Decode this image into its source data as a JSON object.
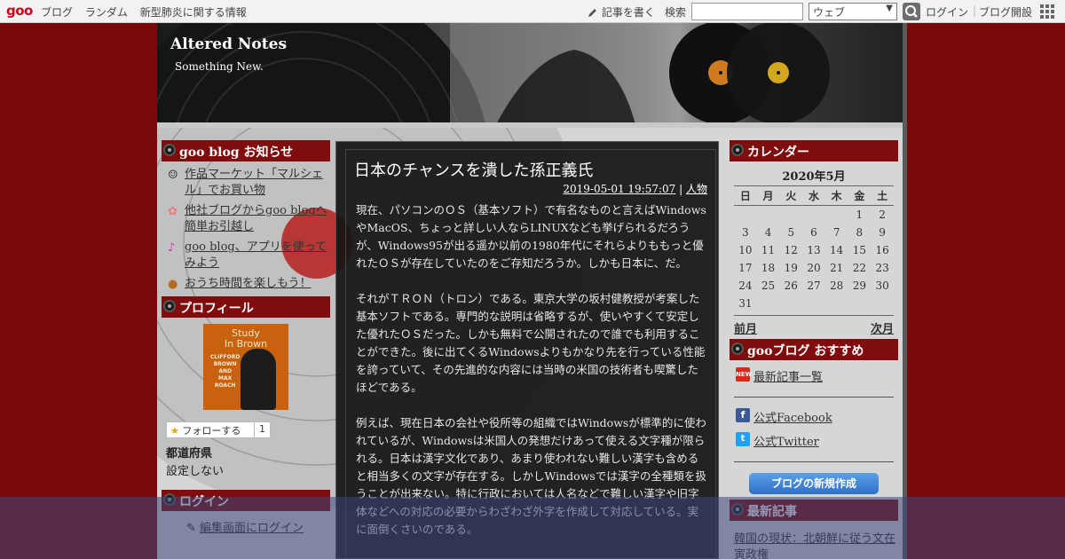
{
  "topbar": {
    "logo": "goo",
    "nav": [
      "ブログ",
      "ランダム",
      "新型肺炎に関する情報"
    ],
    "write": "記事を書く",
    "search_label": "検索",
    "search_value": "",
    "search_select": "ウェブ",
    "login": "ログイン",
    "blog_start": "ブログ開設"
  },
  "header": {
    "title": "Altered Notes",
    "subtitle": "Something New."
  },
  "left": {
    "info_heading": "goo blog お知らせ",
    "info_items": [
      {
        "icon": "smile-icon",
        "text": "作品マーケット「マルシェル」でお買い物"
      },
      {
        "icon": "flower-icon",
        "text": "他社ブログからgoo blogへ簡単お引越し"
      },
      {
        "icon": "music-note-icon",
        "text": "goo blog、アプリを使ってみよう"
      },
      {
        "icon": "dog-icon",
        "text": "おうち時間を楽しもう！"
      }
    ],
    "profile_heading": "プロフィール",
    "album": {
      "line1": "Study",
      "line2": "In Brown",
      "names": "CLIFFORD\nBROWN\nAND\nMAX\nROACH"
    },
    "follow_label": "フォローする",
    "follow_count": "1",
    "pref_label": "都道府県",
    "pref_value": "設定しない",
    "login_heading": "ログイン",
    "login_link": "編集画面にログイン"
  },
  "post": {
    "title": "日本のチャンスを潰した孫正義氏",
    "datetime": "2019-05-01 19:57:07",
    "sep": " | ",
    "category": "人物",
    "paragraphs": [
      "現在、パソコンのＯＳ（基本ソフト）で有名なものと言えばWindowsやMacOS、ちょっと詳しい人ならLINUXなども挙げられるだろうが、Windows95が出る遥か以前の1980年代にそれらよりももっと優れたＯＳが存在していたのをご存知だろうか。しかも日本に、だ。",
      "それがＴＲＯＮ（トロン）である。東京大学の坂村健教授が考案した基本ソフトである。専門的な説明は省略するが、使いやすくて安定した優れたＯＳだった。しかも無料で公開されたので誰でも利用することができた。後に出てくるWindowsよりもかなり先を行っている性能を誇っていて、その先進的な内容には当時の米国の技術者も喫驚したほどである。",
      "例えば、現在日本の会社や役所等の組織ではWindowsが標準的に使われているが、Windowsは米国人の発想だけあって使える文字種が限られる。日本は漢字文化であり、あまり使われない難しい漢字も含めると相当多くの文字が存在する。しかしWindowsでは漢字の全種類を扱うことが出来ない。特に行政においては人名などで難しい漢字や旧字体などへの対応の必要からわざわざ外字を作成して対応している。実に面倒くさいのである。"
    ]
  },
  "right": {
    "cal_heading": "カレンダー",
    "cal_title": "2020年5月",
    "weekdays": [
      "日",
      "月",
      "火",
      "水",
      "木",
      "金",
      "土"
    ],
    "weeks": [
      [
        "",
        "",
        "",
        "",
        "",
        "1",
        "2"
      ],
      [
        "3",
        "4",
        "5",
        "6",
        "7",
        "8",
        "9"
      ],
      [
        "10",
        "11",
        "12",
        "13",
        "14",
        "15",
        "16"
      ],
      [
        "17",
        "18",
        "19",
        "20",
        "21",
        "22",
        "23"
      ],
      [
        "24",
        "25",
        "26",
        "27",
        "28",
        "29",
        "30"
      ],
      [
        "31",
        "",
        "",
        "",
        "",
        "",
        ""
      ]
    ],
    "prev": "前月",
    "next": "次月",
    "rec_heading": "gooブログ おすすめ",
    "rec_latest": "最新記事一覧",
    "new_badge": "NEW",
    "facebook": "公式Facebook",
    "twitter": "公式Twitter",
    "create_btn": "ブログの新規作成",
    "latest_heading": "最新記事",
    "latest_item": "韓国の現状：北朝鮮に従う文在寅政権"
  },
  "colors": {
    "page_bg": "#7a0a0a",
    "heading_bg": "#7f0d0d",
    "logo": "#d0021b",
    "create_btn": "#3a7fd4"
  }
}
